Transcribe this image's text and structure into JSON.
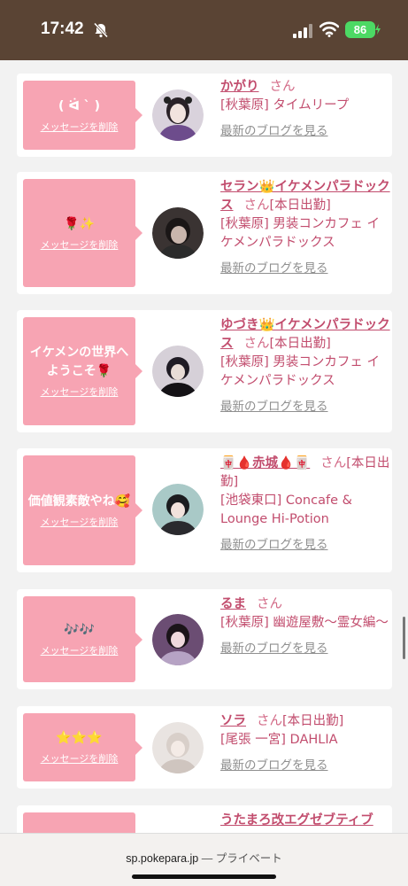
{
  "status_bar": {
    "time": "17:42",
    "battery": "86",
    "icons": [
      "bell-slash-icon",
      "signal-icon",
      "wifi-icon",
      "battery-icon"
    ]
  },
  "feed": {
    "items": [
      {
        "message": "( ᐛ ` )",
        "delete_label": "メッセージを削除",
        "name": "かがり",
        "san": "さん",
        "san_suffix": "",
        "shop": "[秋葉原] タイムリープ",
        "blog_label": "最新のブログを見る"
      },
      {
        "message": "🌹✨",
        "delete_label": "メッセージを削除",
        "name": "セラン👑イケメンパラドックス",
        "san": "さん",
        "san_suffix": "[本日出勤]",
        "shop": "[秋葉原] 男装コンカフェ イケメンパラドックス",
        "blog_label": "最新のブログを見る"
      },
      {
        "message": "イケメンの世界へようこそ🌹",
        "delete_label": "メッセージを削除",
        "name": "ゆづき👑イケメンパラドックス",
        "san": "さん",
        "san_suffix": "[本日出勤]",
        "shop": "[秋葉原] 男装コンカフェ イケメンパラドックス",
        "blog_label": "最新のブログを見る"
      },
      {
        "message": "価値観素敵やね🥰",
        "delete_label": "メッセージを削除",
        "name": "🀄🩸赤城🩸🀄",
        "san": "さん",
        "san_suffix": "[本日出勤]",
        "shop": "[池袋東口] Concafe & Lounge Hi-Potion",
        "blog_label": "最新のブログを見る"
      },
      {
        "message": "🎶🎶",
        "delete_label": "メッセージを削除",
        "name": "るま",
        "san": "さん",
        "san_suffix": "",
        "shop": "[秋葉原] 幽遊屋敷〜霊女編〜",
        "blog_label": "最新のブログを見る"
      },
      {
        "message": "⭐⭐⭐",
        "delete_label": "メッセージを削除",
        "name": "ソラ",
        "san": "さん",
        "san_suffix": "[本日出勤]",
        "shop": "[尾張 一宮] DAHLIA",
        "blog_label": "最新のブログを見る"
      },
      {
        "message": "",
        "delete_label": "",
        "name": "うたまろ改エグゼブティブ",
        "san": "",
        "san_suffix": "",
        "shop": "",
        "blog_label": ""
      }
    ]
  },
  "bottom_bar": {
    "domain": "sp.pokepara.jp",
    "separator": " — ",
    "mode": "プライベート"
  },
  "colors": {
    "status_bar_bg": "#5a4434",
    "bubble_pink": "#f7a4b3",
    "name_pink": "#c24d6e",
    "battery_green": "#4cd964"
  }
}
